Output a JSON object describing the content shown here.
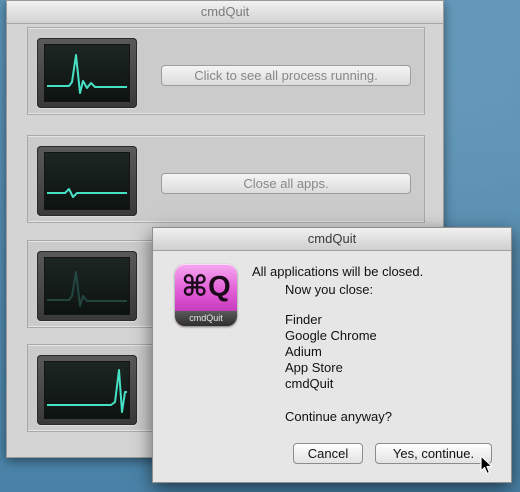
{
  "main_window": {
    "title": "cmdQuit",
    "panels": [
      {
        "button_label": "Click to see all process running."
      },
      {
        "button_label": "Close all apps."
      },
      {
        "button_label": ""
      },
      {
        "button_label": ""
      }
    ]
  },
  "dialog": {
    "title": "cmdQuit",
    "icon": {
      "glyph": "⌘Q",
      "label": "cmdQuit",
      "name": "cmdquit-app-icon"
    },
    "message": "All applications will be closed.",
    "sub_message": "Now you close:",
    "apps": [
      "Finder",
      "Google Chrome",
      "Adium",
      "App Store",
      "cmdQuit"
    ],
    "question": "Continue anyway?",
    "cancel_label": "Cancel",
    "confirm_label": "Yes, continue."
  },
  "colors": {
    "desktop": "#4f88ad",
    "pulse_line": "#46e0c4",
    "icon_accent": "#e15ad6"
  }
}
